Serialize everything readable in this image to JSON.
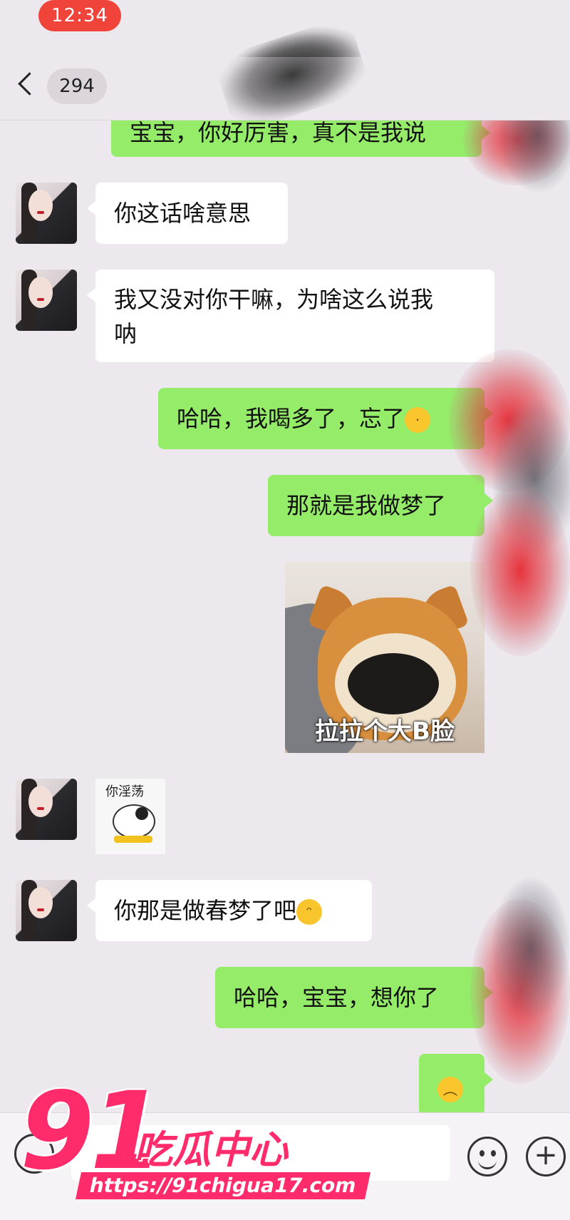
{
  "status_bar": {
    "time": "12:34"
  },
  "header": {
    "back_label": "294"
  },
  "messages": {
    "m0": "宝宝，你好厉害，真不是我说",
    "m1": "你这话啥意思",
    "m2_line1": "我又没对你干嘛，为啥这么说我",
    "m2_line2": "呐",
    "m3": "哈哈，我喝多了，忘了",
    "m4": "那就是我做梦了",
    "dog_sticker_caption": "拉拉个大B脸",
    "cow_sticker_text": "你淫荡",
    "m5": "你那是做春梦了吧",
    "m6": "哈哈，宝宝，想你了"
  },
  "watermark": {
    "number": "91",
    "brand": "吃瓜中心",
    "url": "https://91chigua17.com"
  },
  "icons": [
    "back-chevron-icon",
    "voice-icon",
    "emoji-icon",
    "add-icon",
    "laughing-emoji-icon",
    "grimace-emoji-icon",
    "sad-emoji-icon"
  ],
  "colors": {
    "sent_bubble": "#95ec69",
    "received_bubble": "#ffffff",
    "time_pill": "#f0433a",
    "watermark": "#ff2b6b"
  }
}
